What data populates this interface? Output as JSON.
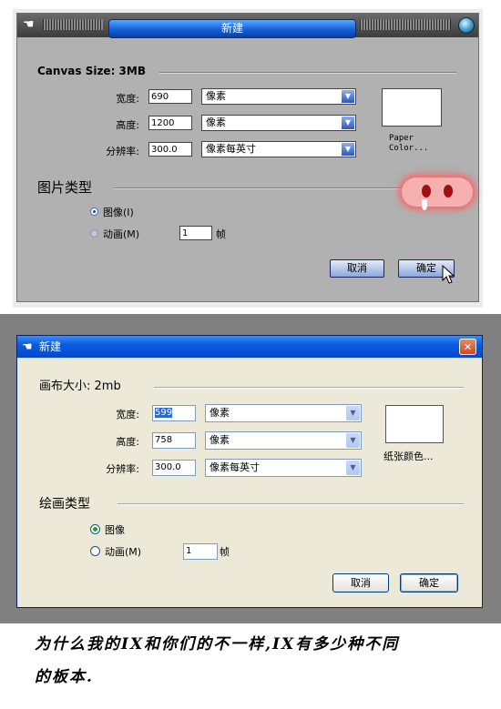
{
  "dialog1": {
    "title": "新建",
    "canvas_size": "Canvas Size: 3MB",
    "width_label": "宽度:",
    "width_value": "690",
    "height_label": "高度:",
    "height_value": "1200",
    "res_label": "分辨率:",
    "res_value": "300.0",
    "unit_pixels": "像素",
    "unit_res": "像素每英寸",
    "paper_color": "Paper\nColor...",
    "paper_color_line1": "Paper",
    "paper_color_line2": "Color...",
    "type_header": "图片类型",
    "radio_image": "图像(I)",
    "radio_anim": "动画(M)",
    "frames_value": "1",
    "frames_unit": "帧",
    "cancel": "取消",
    "ok": "确定"
  },
  "dialog2": {
    "title": "新建",
    "close": "✕",
    "canvas_size": "画布大小: 2mb",
    "width_label": "宽度:",
    "width_value": "599",
    "height_label": "高度:",
    "height_value": "758",
    "res_label": "分辨率:",
    "res_value": "300.0",
    "unit_pixels": "像素",
    "unit_res": "像素每英寸",
    "paper_color": "纸张颜色...",
    "type_header": "绘画类型",
    "radio_image": "图像",
    "radio_anim": "动画(M)",
    "frames_value": "1",
    "frames_unit": "帧",
    "cancel": "取消",
    "ok": "确定"
  },
  "caption": {
    "line1": "为什么我的IX和你们的不一样,IX有多少种不同",
    "line2": "的板本."
  },
  "icons": {
    "title_hand": "hand-cursor-icon",
    "dropdown": "chevron-down-icon",
    "mouse": "arrow-cursor-icon"
  }
}
